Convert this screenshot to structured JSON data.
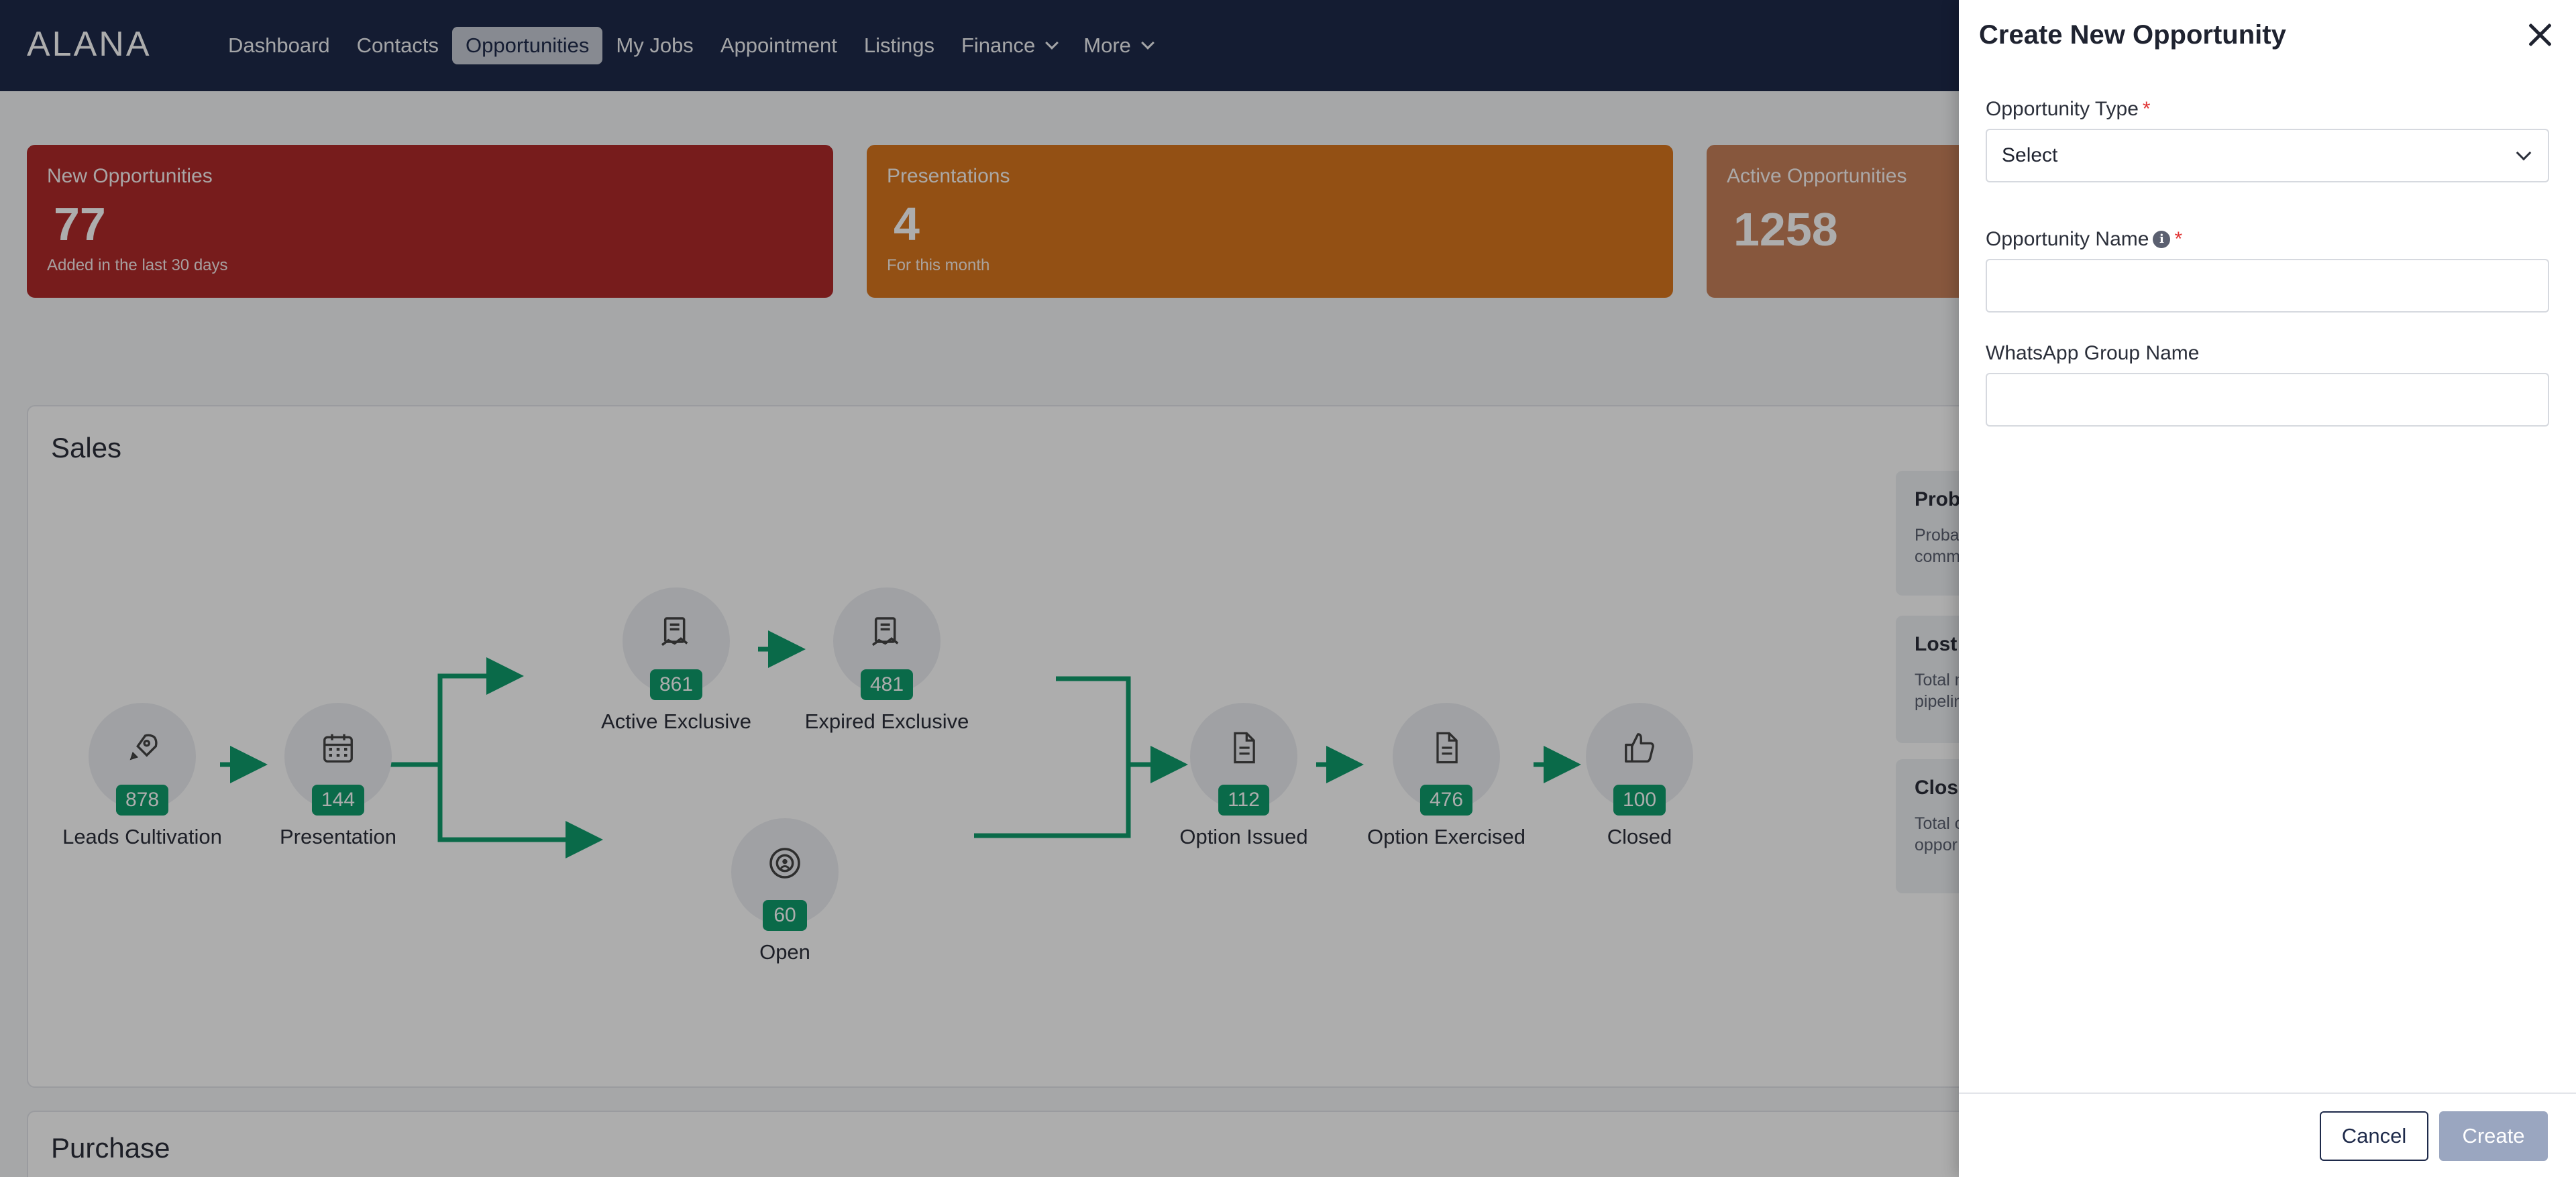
{
  "app": {
    "logo": "ALANA"
  },
  "nav": {
    "items": [
      {
        "label": "Dashboard"
      },
      {
        "label": "Contacts"
      },
      {
        "label": "Opportunities"
      },
      {
        "label": "My Jobs"
      },
      {
        "label": "Appointment"
      },
      {
        "label": "Listings"
      },
      {
        "label": "Finance"
      },
      {
        "label": "More"
      }
    ],
    "active": "Opportunities"
  },
  "stats": [
    {
      "title": "New Opportunities",
      "value": "77",
      "sub": "Added in the last 30 days",
      "color": "#b02a2a"
    },
    {
      "title": "Presentations",
      "value": "4",
      "sub": "For this month",
      "color": "#d9761e"
    },
    {
      "title": "Active Opportunities",
      "value": "1258",
      "sub": "",
      "color": "#c8805a"
    }
  ],
  "sales": {
    "title": "Sales",
    "stages": [
      {
        "label": "Leads Cultivation",
        "count": "878",
        "icon": "rocket-icon"
      },
      {
        "label": "Presentation",
        "count": "144",
        "icon": "calendar-icon"
      },
      {
        "label": "Active Exclusive",
        "count": "861",
        "icon": "contract-icon"
      },
      {
        "label": "Expired Exclusive",
        "count": "481",
        "icon": "contract-icon"
      },
      {
        "label": "Open",
        "count": "60",
        "icon": "vault-icon"
      },
      {
        "label": "Option Issued",
        "count": "112",
        "icon": "document-icon"
      },
      {
        "label": "Option Exercised",
        "count": "476",
        "icon": "document-icon"
      },
      {
        "label": "Closed",
        "count": "100",
        "icon": "thumbs-up-icon"
      }
    ],
    "side_cards": [
      {
        "title": "Proba",
        "desc1": "Proba",
        "desc2": "comm"
      },
      {
        "title": "Lost (",
        "desc1": "Total n",
        "desc2": "pipelin"
      },
      {
        "title": "Close",
        "desc1": "Total c",
        "desc2": "oppor"
      }
    ],
    "flow_color": "#0f9d6c"
  },
  "purchase": {
    "title": "Purchase"
  },
  "drawer": {
    "title": "Create New Opportunity",
    "fields": {
      "type": {
        "label": "Opportunity Type",
        "required_mark": "*",
        "value": "Select"
      },
      "name": {
        "label": "Opportunity Name",
        "required_mark": "*",
        "info": "i",
        "value": ""
      },
      "whatsapp": {
        "label": "WhatsApp Group Name",
        "value": ""
      }
    },
    "buttons": {
      "cancel": "Cancel",
      "create": "Create"
    }
  }
}
